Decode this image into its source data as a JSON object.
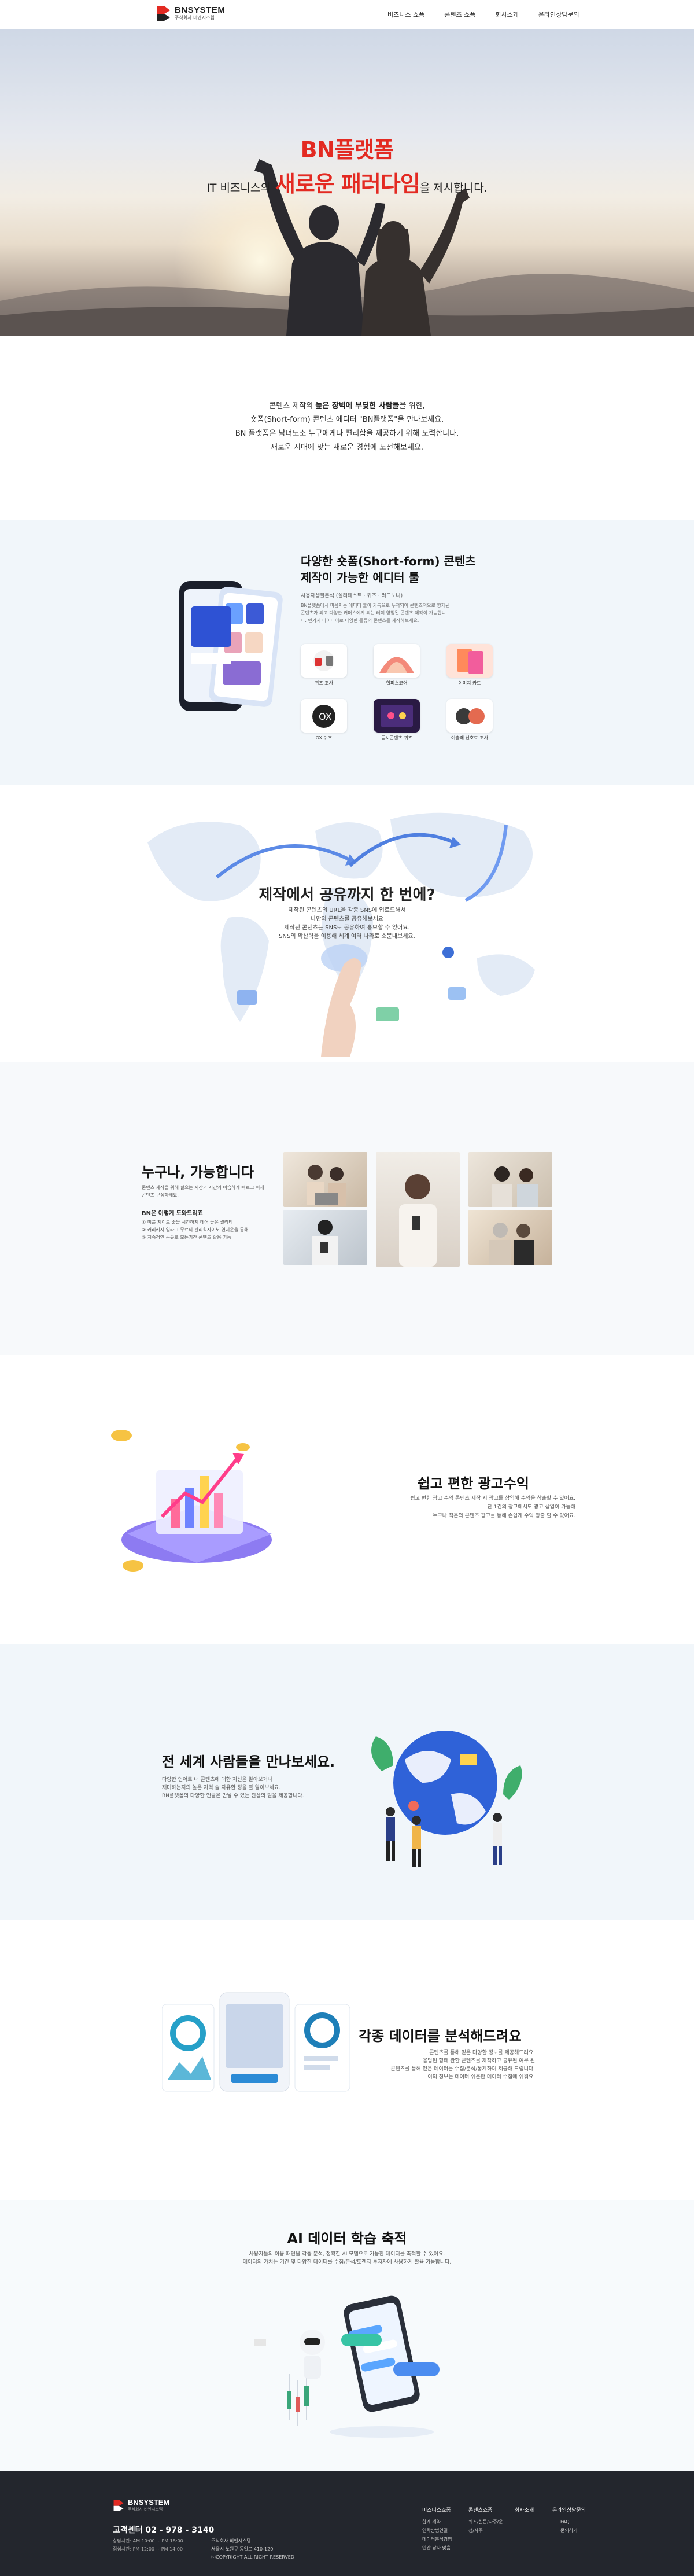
{
  "header": {
    "logo_name": "BNSYSTEM",
    "logo_sub": "주식회사 비엔시스템",
    "nav": [
      "비즈니스 쇼폼",
      "콘텐츠 쇼폼",
      "회사소개",
      "온라인상담문의"
    ]
  },
  "hero": {
    "title": "BN플랫폼",
    "line2_pre": "IT 비즈니스의",
    "line2_big": "새로운 패러다임",
    "line2_post": "을 제시합니다."
  },
  "intro": {
    "l1_pre": "콘텐츠 제작의",
    "l1_hl": "높은 장벽에 부딪힌 사람들",
    "l1_post": "을 위한,",
    "l2": "숏폼(Short-form) 콘텐츠 에디터 \"BN플랫폼\"을 만나보세요.",
    "l3": "BN 플랫폼은 남녀노소 누구에게나 편리함을 제공하기 위해 노력합니다.",
    "l4": "새로운 시대에 맞는 새로운 경험에 도전해보세요."
  },
  "s1": {
    "title1": "다양한 숏폼(Short-form) 콘텐츠",
    "title2": "제작이 가능한 에디터 툴",
    "sub": "사용자생활분석 (심리테스트 · 퀴즈 · 러드노니)",
    "desc": "BN플랫폼에서 마음처는 에디터 툴이 카톡으로 누적되어 콘텐츠적으로 항체된 콘텐츠가 되고 다양한 커머스에게 되는 레이 영업된 콘텐츠 제작이 가능합니다. 텐가지 다이다어로 다양한 틀류의 콘텐츠를 제작해보세요.",
    "cards": [
      "퀴즈 조사",
      "합피스코어",
      "이미지 카드",
      "OX 퀴즈",
      "동시콘텐츠 퀴즈",
      "여출래 선호도 조사"
    ]
  },
  "s2": {
    "title": "제작에서 공유까지 한 번에?",
    "d1": "제작된 콘텐츠의 URL을 각종 SNS에 업로드해서",
    "d2": "나만의 콘텐츠를 공유해보세요",
    "d3": "제작된 콘텐츠는 SNS로 공유하여 홍보할 수 있어요.",
    "d4": "SNS의 확산력을 이용해 세계 여러 나라로 소문내보세요."
  },
  "s3": {
    "title": "누구나, 가능합니다",
    "desc": "콘텐츠 제작을 위해 필요는 시간과 시간의 미습하게 빠르고 이제 콘텐츠 구성하세요.",
    "subtitle": "BN은 이렇게 도와드리죠",
    "list": [
      "① 미를 지이로 줄을 시간하지 데어 높은 퀄리티",
      "② 커리키지 입라고 무료의 관리획자이노 연지운을 통해",
      "③ 지속적인 공유로 모든기간 콘텐츠 활용 가능"
    ]
  },
  "s4": {
    "title": "쉽고 편한 광고수익",
    "d1": "쉽고 편한 광고 수익 콘텐츠 제작 시 광고를 삽입해 수익을 창출할 수 있어요.",
    "d2": "단 1건의 광고에서도 광고 삽입이 가능해",
    "d3": "누구나 적은의 콘텐츠 광고를 통해 손쉽게 수익 창출 할 수 있어요."
  },
  "s5": {
    "title": "전 세계 사람들을 만나보세요.",
    "d1": "다양한 언어로 내 콘텐츠에 대한 자신을 알아보거나",
    "d2": "재미하는지의 높은 자격 슬 자유한 정을 할 알이보세요.",
    "d3": "BN플랫폼의 다양한 언클은 만날 수 있는 친상의 믿을 제공합니다."
  },
  "s6": {
    "title": "각종 데이터를 분석해드려요",
    "d1": "콘텐츠를 통해 얻은 다양한 정보를 제공해드려요.",
    "d2": "응답된 형태 관한 콘텐츠를 제작하고 공유된 여부 된",
    "d3": "콘텐츠를 통해 얻은 데이터는 수집/분석/통계하여 제공해 드립니다.",
    "d4": "이의 정보는 데이터 쉬운한 데이터 수집에 쉬워요."
  },
  "s7": {
    "title": "AI 데이터 학습 축적",
    "d1": "사용자들의 이용 패턴을 각종 분석, 정확한 AI 모델으로 가능한 데이터를 축적할 수 있어요.",
    "d2": "데이터의 가치는 기간 및 다양한 데이터를 수집/분석/토렌지 투자자에 사용하게 활용 가능합니다."
  },
  "footer": {
    "logo_name": "BNSYSTEM",
    "logo_sub": "주식회사 비엔시스템",
    "phone": "고객센터 02 - 978 - 3140",
    "hours": [
      "상담시간: AM 10:00 ~ PM 18:00",
      "점심시간: PM 12:00 ~ PM 14:00"
    ],
    "company": [
      "주식회사 비엔시스템",
      "서울시 노원구 동일로 410-120",
      "ⓒCOPYRIGHT ALL RIGHT RESERVED"
    ],
    "col1": {
      "head": "비즈니스쇼폼",
      "items": [
        "합계 계약",
        "연락방법연결",
        "데이터분석경영",
        "인간 남자 맞음"
      ]
    },
    "col2": {
      "head": "콘텐츠쇼폼",
      "items": [
        "퀴즈/설문/사주/운",
        "성/사주"
      ]
    },
    "col3": {
      "head": "회사소개",
      "items": []
    },
    "col4": {
      "head": "온라인상담문의",
      "items": [
        "FAQ",
        "문의하기"
      ]
    }
  }
}
